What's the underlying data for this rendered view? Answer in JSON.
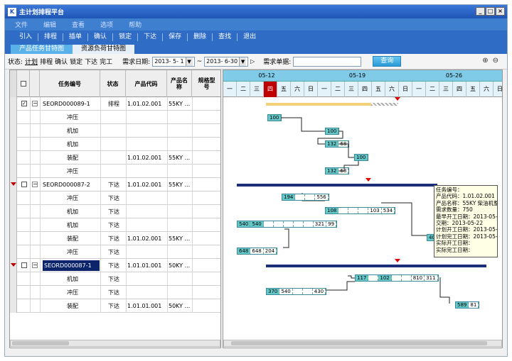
{
  "window": {
    "title": "主计划排程平台"
  },
  "menu": [
    "文件",
    "编辑",
    "查看",
    "选项",
    "帮助"
  ],
  "toolbar": [
    "引入",
    "排程",
    "插单",
    "确认",
    "锁定",
    "下达",
    "保存",
    "删除",
    "查找",
    "退出"
  ],
  "tabs": [
    "产品任务甘特图",
    "资源负荷甘特图"
  ],
  "filter": {
    "status_label": "状态:",
    "statuses": [
      "计划",
      "排程",
      "确认",
      "锁定",
      "下达",
      "完工"
    ],
    "date_label": "需求日期:",
    "date_from": "2013- 5- 1",
    "date_to": "2013- 6-30",
    "range_sep": "~",
    "order_label": "需求单据:",
    "order_value": "",
    "query_button": "查询"
  },
  "grid": {
    "headers": [
      "任务编号",
      "状态",
      "产品代码",
      "产品名称",
      "规格型号"
    ],
    "rows": [
      {
        "checked": true,
        "expander": "−",
        "task": "SEORD000089-1",
        "status": "排程",
        "code": "1.01.02.001",
        "name": "55KY ...",
        "spec": "",
        "mark": false
      },
      {
        "task": "冲压"
      },
      {
        "task": "机加"
      },
      {
        "task": "机加"
      },
      {
        "task": "装配",
        "code": "1.01.02.001",
        "name": "55KY ..."
      },
      {
        "task": "冲压"
      },
      {
        "checked": false,
        "expander": "−",
        "task": "SEORD000087-2",
        "status": "下达",
        "code": "1.01.02.001",
        "name": "55KY ...",
        "mark": true
      },
      {
        "task": "冲压",
        "status": "下达"
      },
      {
        "task": "机加",
        "status": "下达"
      },
      {
        "task": "机加",
        "status": "下达"
      },
      {
        "task": "装配",
        "status": "下达",
        "code": "1.01.02.001",
        "name": "55KY ..."
      },
      {
        "task": "冲压",
        "status": "下达"
      },
      {
        "checked": false,
        "expander": "−",
        "task": "SEORD000087-1",
        "status": "下达",
        "code": "1.01.01.001",
        "name": "50KY ...",
        "mark": true,
        "selected": true
      },
      {
        "task": "机加",
        "status": "下达"
      },
      {
        "task": "冲压",
        "status": "下达"
      },
      {
        "task": "装配",
        "status": "下达",
        "code": "1.01.01.001",
        "name": "50KY ..."
      }
    ]
  },
  "gantt": {
    "weeks": [
      "05-12",
      "05-19",
      "05-26"
    ],
    "days": [
      "一",
      "二",
      "三",
      "四",
      "五",
      "六",
      "日",
      "一",
      "二",
      "三",
      "四",
      "五",
      "六",
      "日",
      "一",
      "二",
      "三",
      "四",
      "五",
      "六",
      "日"
    ],
    "bars": {
      "b1": [
        "100"
      ],
      "b2": [
        "100"
      ],
      "b3": [
        "132",
        "68"
      ],
      "b4": [
        "100"
      ],
      "b5": [
        "132",
        "68"
      ],
      "b6": [
        "194",
        "",
        "",
        "556"
      ],
      "b7": [
        "108",
        "",
        "",
        "",
        "103",
        "534"
      ],
      "b8": [
        "540",
        "540",
        "",
        "",
        "",
        "",
        "",
        "321",
        "99"
      ],
      "b9": [
        "648",
        "648",
        "204"
      ],
      "b10": [
        "117",
        "",
        "102",
        "",
        "",
        "810",
        "311"
      ],
      "b11": [
        "370",
        "540",
        "",
        "",
        "430"
      ],
      "b12": [
        "589",
        "81"
      ],
      "b13": [
        "40"
      ]
    },
    "tooltip": {
      "task": "任务编号：",
      "product_code": "产品代码：1.01.02.001",
      "product_name": "产品名称：55KY 柴油机整机",
      "demand_qty": "需求数量：750",
      "earliest_start": "最早开工日期：2013-05-06",
      "delivery": "交期：2013-05-22",
      "plan_start": "计划开工日期：2013-05-14",
      "plan_finish": "计划完工日期：2013-05-28",
      "actual_start": "实际开工日期：",
      "actual_finish": "实际完工日期："
    }
  },
  "colors": {
    "title": "#1f55b5",
    "tab_active": "#5ab0e8",
    "bar_fill": "#66c8c8",
    "summary": "#1b2e7a",
    "marker": "#e00000"
  }
}
